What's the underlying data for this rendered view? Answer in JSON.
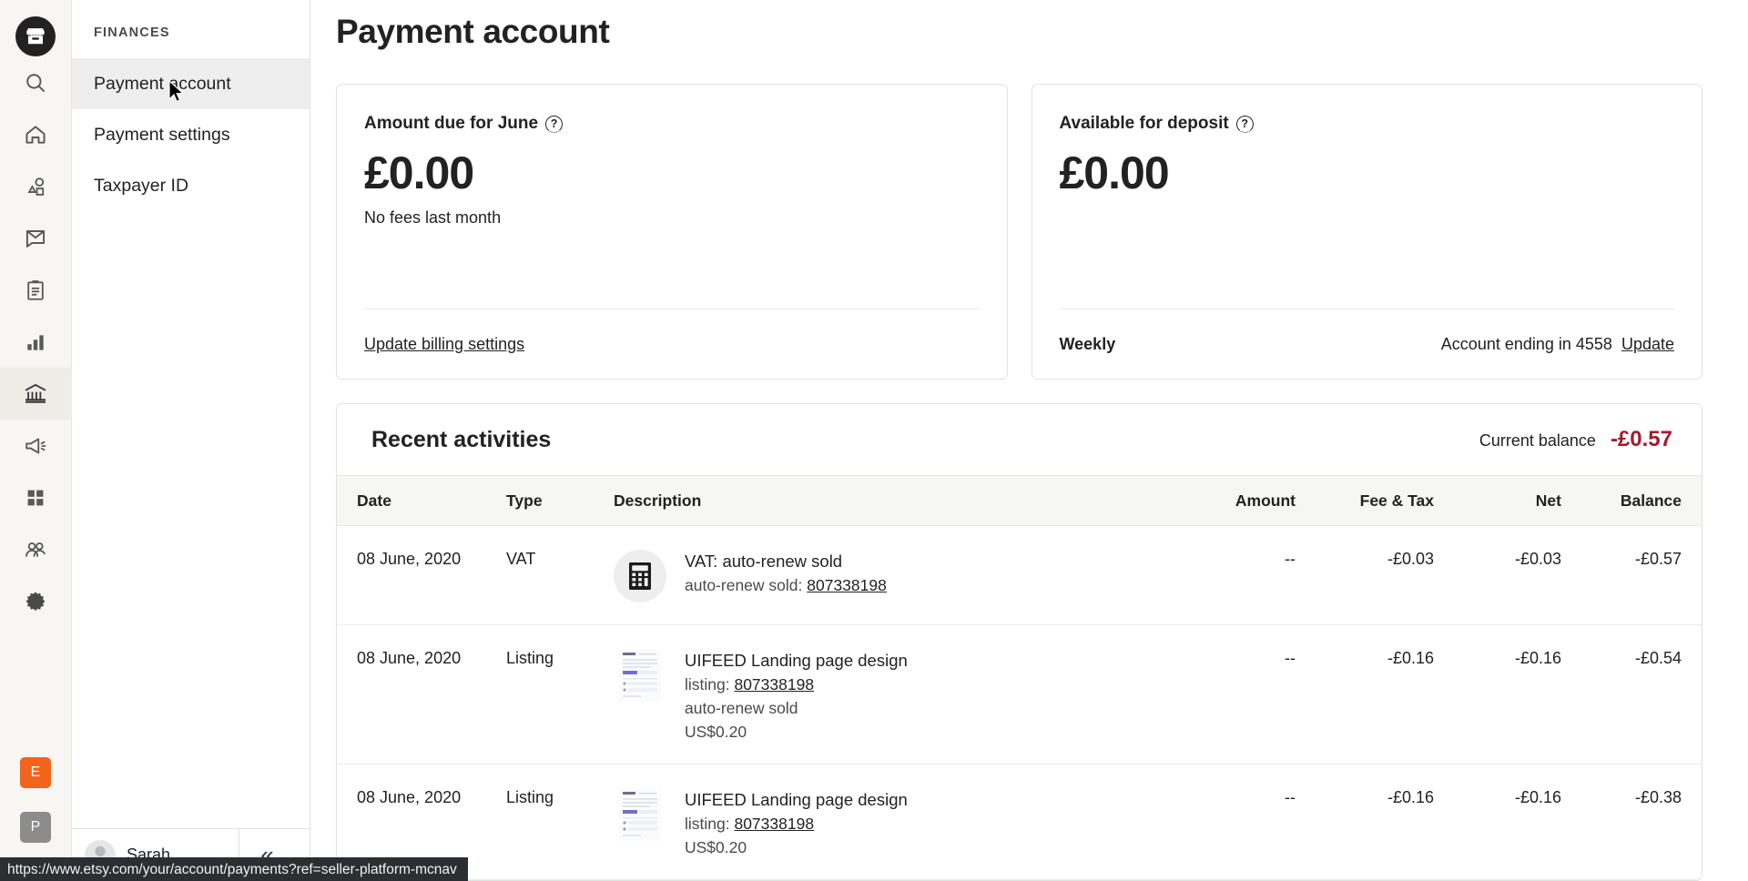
{
  "window": {
    "status_bar_url": "https://www.etsy.com/your/account/payments?ref=seller-platform-mcnav"
  },
  "icon_rail": {
    "logo_name": "shop-logo",
    "items": [
      {
        "name": "search-icon",
        "active": false
      },
      {
        "name": "home-icon",
        "active": false
      },
      {
        "name": "listings-icon",
        "active": false
      },
      {
        "name": "messages-icon",
        "active": false
      },
      {
        "name": "orders-icon",
        "active": false
      },
      {
        "name": "stats-icon",
        "active": false
      },
      {
        "name": "finances-icon",
        "active": true
      },
      {
        "name": "marketing-icon",
        "active": false
      },
      {
        "name": "apps-icon",
        "active": false
      },
      {
        "name": "community-icon",
        "active": false
      },
      {
        "name": "settings-icon",
        "active": false
      }
    ],
    "badges": [
      {
        "label": "E",
        "name": "etsy-badge",
        "color": "#f1641e"
      },
      {
        "label": "P",
        "name": "pattern-badge",
        "color": "#8c8c8c"
      }
    ]
  },
  "sidebar": {
    "title": "FINANCES",
    "items": [
      {
        "label": "Payment account",
        "active": true
      },
      {
        "label": "Payment settings",
        "active": false
      },
      {
        "label": "Taxpayer ID",
        "active": false
      }
    ],
    "user": {
      "name": "Sarah",
      "caret": "▲"
    },
    "collapse_glyph": "«"
  },
  "header": {
    "title": "Payment account"
  },
  "cards": [
    {
      "label": "Amount due for June",
      "help_glyph": "?",
      "amount": "£0.00",
      "subtitle": "No fees last month",
      "footer_link": "Update billing settings"
    },
    {
      "label": "Available for deposit",
      "help_glyph": "?",
      "amount": "£0.00",
      "footer_left": "Weekly",
      "footer_right_text": "Account ending in 4558",
      "footer_right_link": "Update"
    }
  ],
  "activities": {
    "title": "Recent activities",
    "balance_label": "Current balance",
    "balance_value": "-£0.57",
    "balance_color": "#a61a2e",
    "columns": [
      "Date",
      "Type",
      "Description",
      "Amount",
      "Fee & Tax",
      "Net",
      "Balance"
    ],
    "rows": [
      {
        "date": "08 June, 2020",
        "type": "VAT",
        "thumb": "calculator-icon",
        "desc_main": "VAT: auto-renew sold",
        "desc_sub_prefix": "auto-renew sold: ",
        "desc_sub_link": "807338198",
        "desc_extra": [],
        "amount": "--",
        "fee_tax": "-£0.03",
        "net": "-£0.03",
        "balance": "-£0.57"
      },
      {
        "date": "08 June, 2020",
        "type": "Listing",
        "thumb": "listing-thumbnail",
        "desc_main": "UIFEED Landing page design",
        "desc_sub_prefix": "listing: ",
        "desc_sub_link": "807338198",
        "desc_extra": [
          "auto-renew sold",
          "US$0.20"
        ],
        "amount": "--",
        "fee_tax": "-£0.16",
        "net": "-£0.16",
        "balance": "-£0.54"
      },
      {
        "date": "08 June, 2020",
        "type": "Listing",
        "thumb": "listing-thumbnail",
        "desc_main": "UIFEED Landing page design",
        "desc_sub_prefix": "listing: ",
        "desc_sub_link": "807338198",
        "desc_extra": [
          "US$0.20"
        ],
        "amount": "--",
        "fee_tax": "-£0.16",
        "net": "-£0.16",
        "balance": "-£0.38"
      }
    ]
  }
}
